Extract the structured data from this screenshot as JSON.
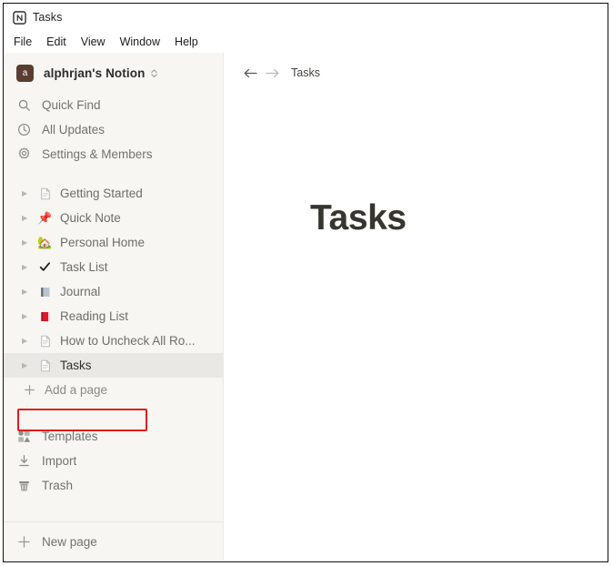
{
  "window": {
    "titlebar": {
      "icon": "notion-logo-icon",
      "title": "Tasks"
    },
    "menubar": [
      {
        "label": "File"
      },
      {
        "label": "Edit"
      },
      {
        "label": "View"
      },
      {
        "label": "Window"
      },
      {
        "label": "Help"
      }
    ]
  },
  "sidebar": {
    "workspace": {
      "avatar_letter": "a",
      "avatar_color": "#5a3d32",
      "name": "alphrjan's Notion",
      "switcher_icon": "chevron-up-down-icon"
    },
    "nav_items": [
      {
        "label": "Quick Find",
        "icon": "search-icon"
      },
      {
        "label": "All Updates",
        "icon": "clock-icon"
      },
      {
        "label": "Settings & Members",
        "icon": "gear-icon"
      }
    ],
    "pages": [
      {
        "label": "Getting Started",
        "icon": "document-icon",
        "active": false
      },
      {
        "label": "Quick Note",
        "icon": "pushpin-icon",
        "active": false
      },
      {
        "label": "Personal Home",
        "icon": "house-with-garden-icon",
        "active": false
      },
      {
        "label": "Task List",
        "icon": "check-mark-icon",
        "active": false
      },
      {
        "label": "Journal",
        "icon": "notebook-icon",
        "active": false
      },
      {
        "label": "Reading List",
        "icon": "closed-book-icon",
        "active": false
      },
      {
        "label": "How to Uncheck All Ro...",
        "icon": "document-icon",
        "active": false
      },
      {
        "label": "Tasks",
        "icon": "document-icon",
        "active": true
      }
    ],
    "add_page": {
      "label": "Add a page",
      "icon": "plus-icon"
    },
    "utilities": [
      {
        "label": "Templates",
        "icon": "templates-icon"
      },
      {
        "label": "Import",
        "icon": "import-download-icon"
      },
      {
        "label": "Trash",
        "icon": "trash-icon"
      }
    ],
    "new_page": {
      "label": "New page",
      "icon": "plus-icon"
    },
    "annotation": {
      "target": "Tasks",
      "color": "#e51b1b",
      "shape": "rectangle"
    }
  },
  "content": {
    "breadcrumb": {
      "back_icon": "arrow-left-icon",
      "forward_icon": "arrow-right-icon",
      "crumb": "Tasks"
    },
    "page_title": "Tasks"
  }
}
